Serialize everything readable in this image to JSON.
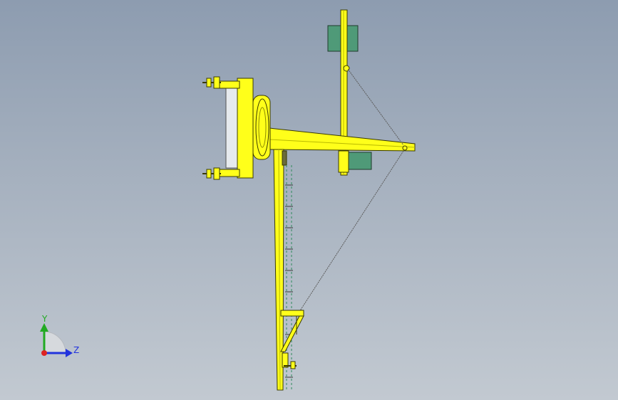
{
  "view": {
    "background_top": "#8d9cb0",
    "background_bottom": "#c2c9d1"
  },
  "model": {
    "part_color": "#ffff1a",
    "edge_color": "#3a3a00",
    "motor_color": "#4f9a78",
    "cable_color": "#5c5c5c",
    "scale_color": "#2f8a5c"
  },
  "triad": {
    "y_label": "Y",
    "z_label": "Z",
    "y_color": "#22aa22",
    "z_color": "#2233dd",
    "origin_color": "#dd2222"
  }
}
